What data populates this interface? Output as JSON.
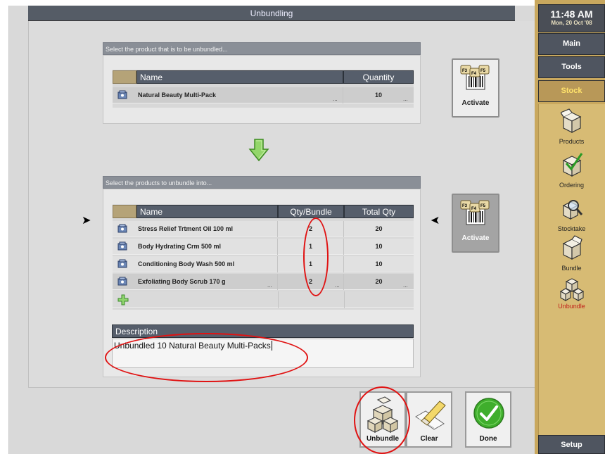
{
  "window": {
    "title": "Unbundling"
  },
  "clock": {
    "time": "11:48 AM",
    "date": "Mon, 20 Oct '08"
  },
  "nav": {
    "main": "Main",
    "tools": "Tools",
    "stock": "Stock",
    "setup": "Setup"
  },
  "sidebar_items": [
    {
      "label": "Products",
      "icon": "box-icon"
    },
    {
      "label": "Ordering",
      "icon": "box-check-icon"
    },
    {
      "label": "Stocktake",
      "icon": "magnifier-box-icon"
    },
    {
      "label": "Bundle",
      "icon": "box-icon"
    },
    {
      "label": "Unbundle",
      "icon": "boxes-icon",
      "active": true
    }
  ],
  "source": {
    "header": "Select the product that is to be unbundled...",
    "columns": {
      "name": "Name",
      "quantity": "Quantity"
    },
    "row": {
      "name": "Natural Beauty Multi-Pack",
      "quantity": "10",
      "ellipsis": "..."
    },
    "activate_label": "Activate"
  },
  "target": {
    "header": "Select the products to unbundle into...",
    "columns": {
      "name": "Name",
      "qty_bundle": "Qty/Bundle",
      "total_qty": "Total Qty"
    },
    "rows": [
      {
        "name": "Stress Relief Trtment Oil 100 ml",
        "qty_bundle": "2",
        "total_qty": "20"
      },
      {
        "name": "Body Hydrating Crm 500 ml",
        "qty_bundle": "1",
        "total_qty": "10"
      },
      {
        "name": "Conditioning Body Wash 500 ml",
        "qty_bundle": "1",
        "total_qty": "10"
      },
      {
        "name": "Exfoliating Body Scrub 170 g",
        "qty_bundle": "2",
        "total_qty": "20",
        "ellipsis": "..."
      }
    ],
    "activate_label": "Activate"
  },
  "description": {
    "label": "Description",
    "value": "Unbundled 10 Natural Beauty Multi-Packs"
  },
  "buttons": {
    "unbundle": "Unbundle",
    "clear": "Clear",
    "done": "Done"
  },
  "colors": {
    "accent_gold": "#c9a85e",
    "header_dark": "#565e6b",
    "active_text": "#ffe26b",
    "annotation_red": "#e01212",
    "done_green": "#3fae2c"
  }
}
